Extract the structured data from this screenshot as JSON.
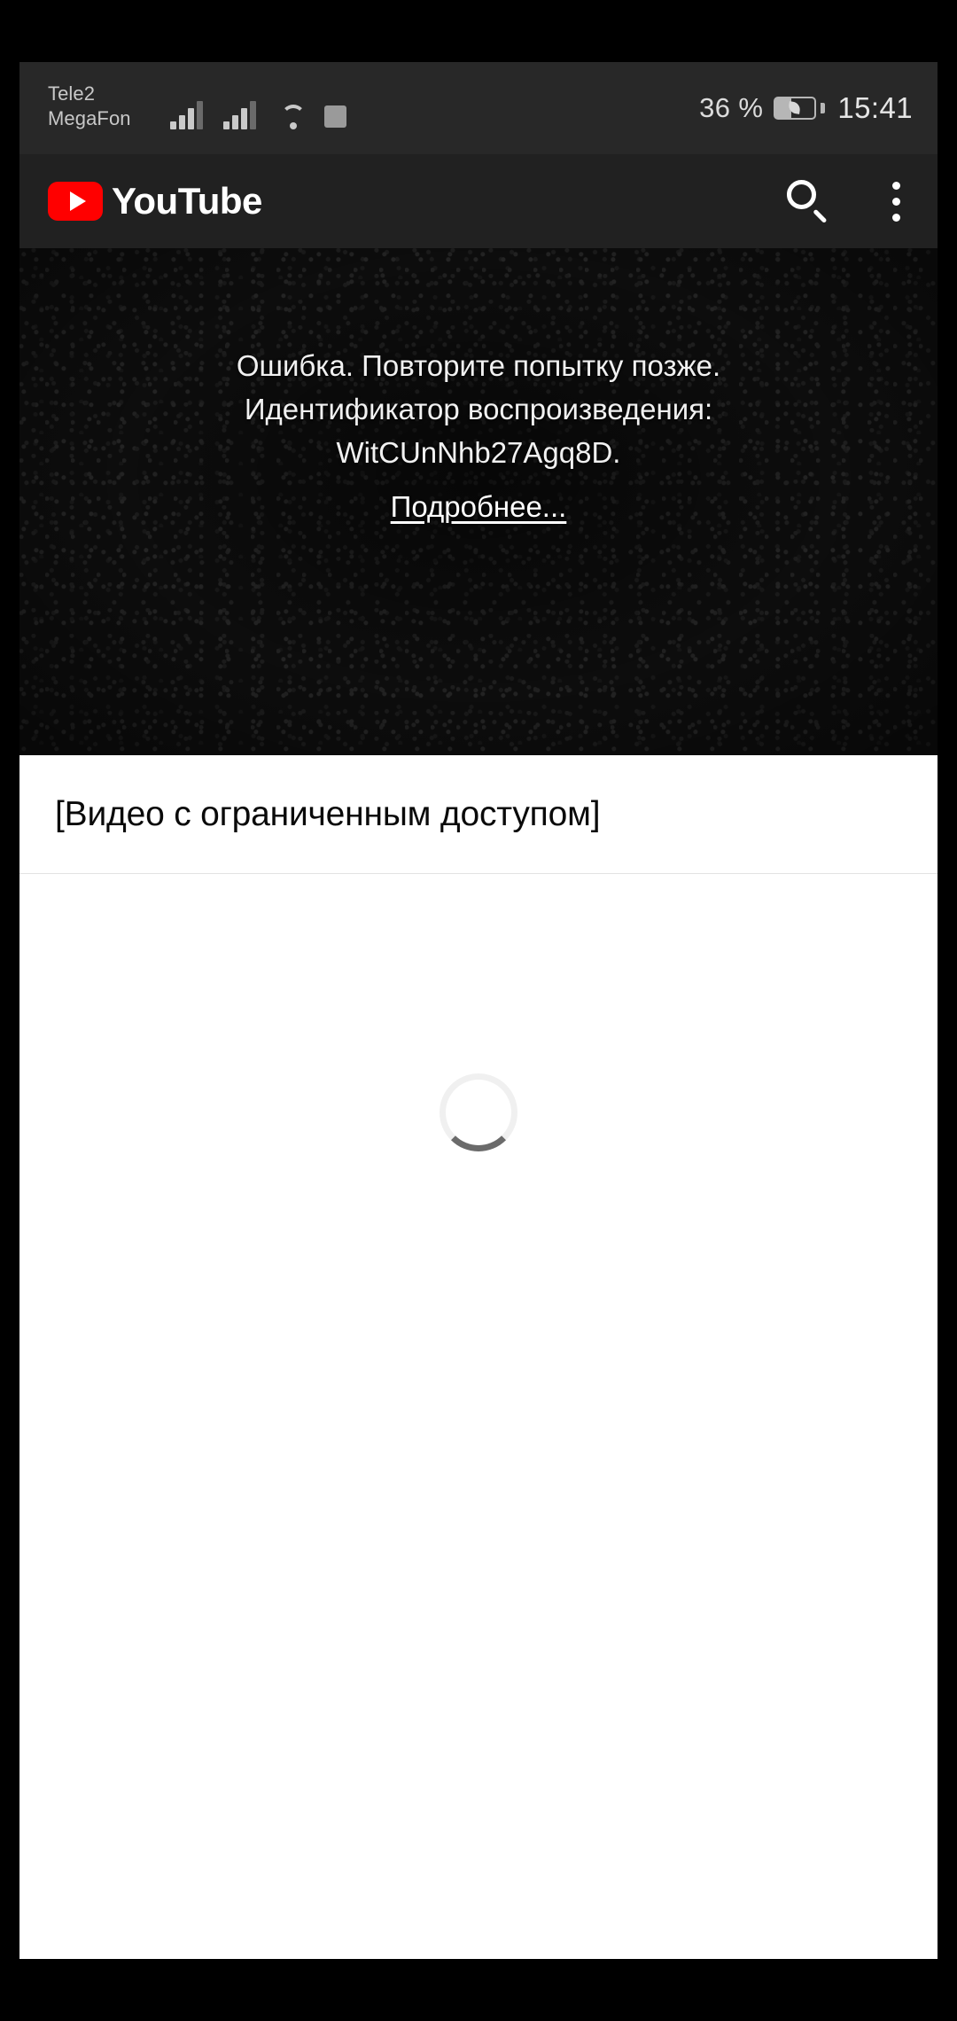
{
  "status_bar": {
    "carriers": [
      "Tele2",
      "MegaFon"
    ],
    "signal_icon_1": "signal-bars-icon",
    "signal_icon_2": "signal-bars-icon",
    "wifi_icon": "wifi-icon",
    "extra_icon": "square-indicator-icon",
    "battery_percent": "36 %",
    "battery_icon": "battery-saver-icon",
    "time": "15:41",
    "background_color": "#282828"
  },
  "header": {
    "logo_text": "YouTube",
    "logo_mark": "youtube-play-icon",
    "logo_color": "#FF0000",
    "search_icon": "search-icon",
    "menu_icon": "more-vertical-icon",
    "background_color": "#212121"
  },
  "player": {
    "error_line_1": "Ошибка. Повторите попытку позже.",
    "error_line_2": "Идентификатор воспроизведения:",
    "error_line_3": "WitCUnNhb27Agq8D.",
    "more_link": "Подробнее...",
    "background_color": "#101010",
    "text_color": "#f1f1f1"
  },
  "video": {
    "title": "[Видео с ограниченным доступом]"
  },
  "content": {
    "spinner_icon": "loading-spinner-icon",
    "background_color": "#ffffff"
  }
}
